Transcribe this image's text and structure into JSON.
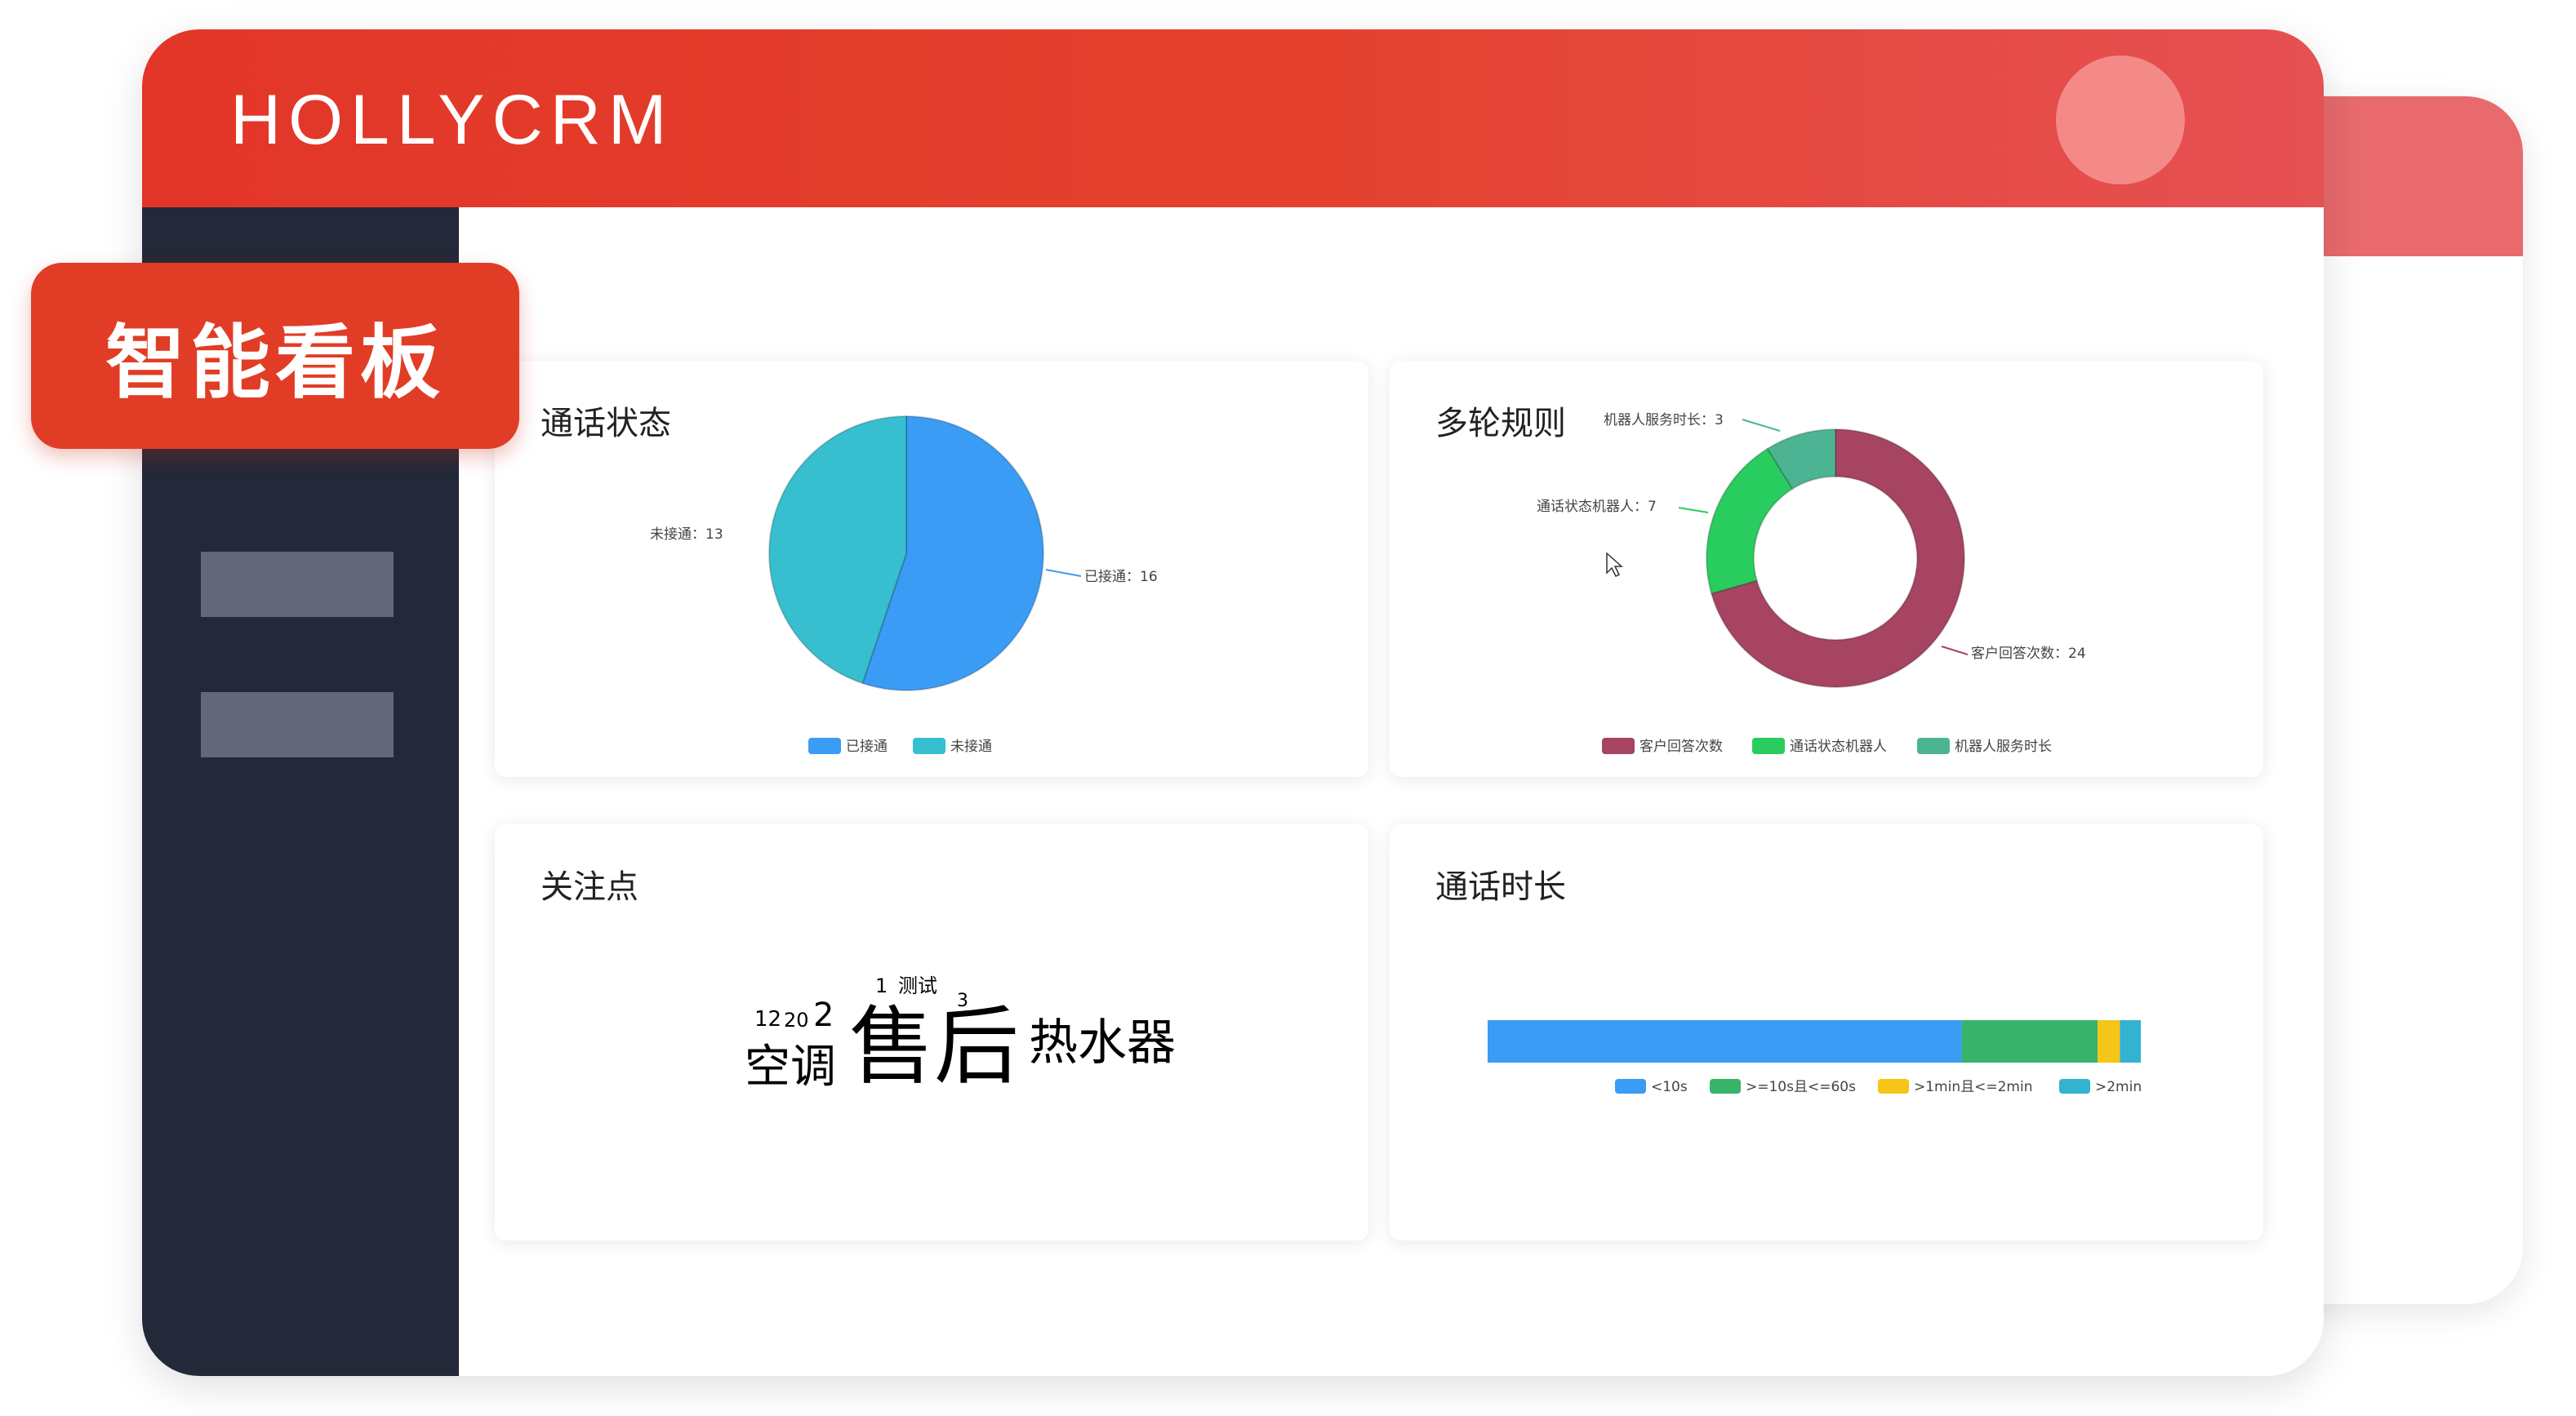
{
  "app": {
    "brand": "HOLLYCRM"
  },
  "badge": {
    "label": "智能看板"
  },
  "sidebar": {
    "items": [
      {
        "label": ""
      },
      {
        "label": ""
      }
    ]
  },
  "cards": {
    "call_status": {
      "title": "通话状态",
      "chart_data": {
        "type": "pie",
        "labels": [
          "已接通",
          "未接通"
        ],
        "values": [
          16,
          13
        ],
        "colors": [
          "#3a9cf5",
          "#37bfcf"
        ],
        "slice_labels": [
          "已接通：16",
          "未接通：13"
        ],
        "legend": [
          "已接通",
          "未接通"
        ],
        "legend_position": "bottom"
      }
    },
    "multi_round": {
      "title": "多轮规则",
      "chart_data": {
        "type": "pie",
        "labels": [
          "客户回答次数",
          "通话状态机器人",
          "机器人服务时长"
        ],
        "values": [
          24,
          7,
          3
        ],
        "colors": [
          "#a64461",
          "#29cc5f",
          "#4db493"
        ],
        "slice_labels": [
          "客户回答次数：24",
          "通话状态机器人：7",
          "机器人服务时长：3"
        ],
        "legend": [
          "客户回答次数",
          "通话状态机器人",
          "机器人服务时长"
        ],
        "legend_position": "bottom"
      }
    },
    "focus": {
      "title": "关注点",
      "words": [
        {
          "text": "售后",
          "color": "#9a2a6c"
        },
        {
          "text": "热水器",
          "color": "#c74ab3"
        },
        {
          "text": "空调",
          "color": "#c4532a"
        },
        {
          "text": "12",
          "color": "#222222"
        },
        {
          "text": "20",
          "color": "#e99a9a"
        },
        {
          "text": "2",
          "color": "#222222"
        },
        {
          "text": "1",
          "color": "#222222"
        },
        {
          "text": "测试",
          "color": "#c070c0"
        },
        {
          "text": "3",
          "color": "#777777"
        }
      ]
    },
    "duration": {
      "title": "通话时长",
      "chart_data": {
        "type": "bar",
        "orientation": "horizontal-stacked",
        "categories": [
          "<10s",
          ">=10s且<=60s",
          ">1min且<=2min",
          ">2min"
        ],
        "values": [
          68,
          19.5,
          3.2,
          3.0
        ],
        "colors": [
          "#3a9cf5",
          "#38b36a",
          "#f5c518",
          "#33b3cf"
        ],
        "legend": [
          "<10s",
          ">=10s且<=60s",
          ">1min且<=2min",
          ">2min"
        ],
        "legend_position": "bottom"
      }
    }
  }
}
